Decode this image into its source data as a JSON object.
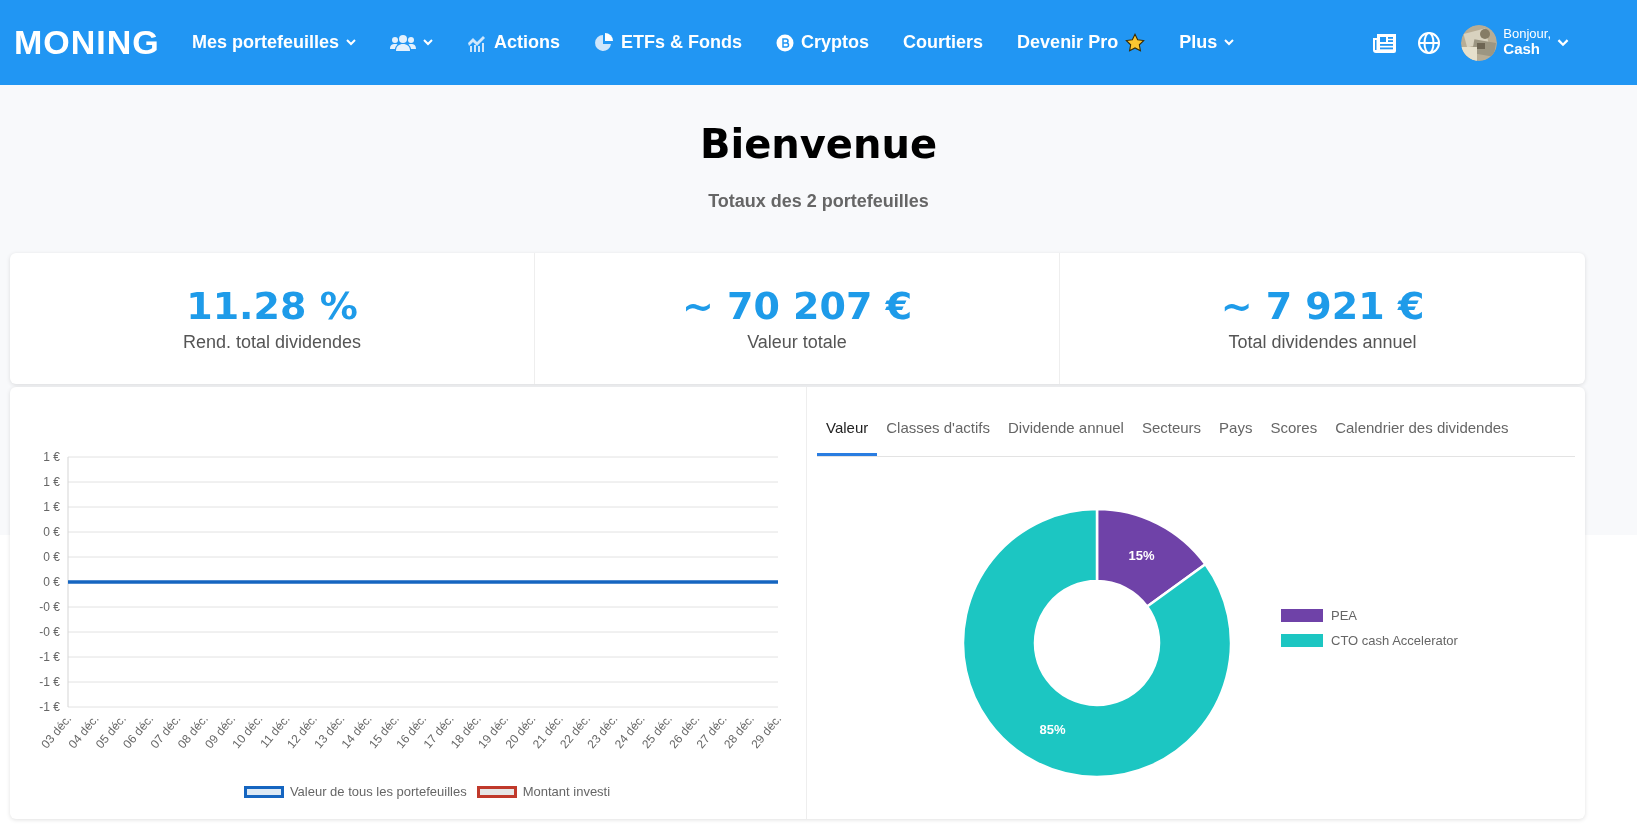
{
  "nav": {
    "brand": "MONING",
    "items": [
      {
        "kind": "menu",
        "label": "Mes portefeuilles",
        "dropdown": true
      },
      {
        "kind": "people",
        "dropdown": true
      },
      {
        "kind": "stocks",
        "label": "Actions",
        "dropdown": false
      },
      {
        "kind": "funds",
        "label": "ETFs & Fonds",
        "dropdown": false
      },
      {
        "kind": "crypto",
        "label": "Cryptos",
        "dropdown": false
      },
      {
        "kind": "menu",
        "label": "Courtiers",
        "dropdown": false
      },
      {
        "kind": "pro",
        "label": "Devenir Pro",
        "dropdown": false
      },
      {
        "kind": "menu",
        "label": "Plus",
        "dropdown": true
      }
    ],
    "user": {
      "greeting": "Bonjour,",
      "name": "Cash"
    }
  },
  "hero": {
    "title": "Bienvenue",
    "subtitle": "Totaux des 2 portefeuilles"
  },
  "stats": [
    {
      "value": "11.28 %",
      "label": "Rend. total dividendes"
    },
    {
      "value": "~ 70 207 €",
      "label": "Valeur totale"
    },
    {
      "value": "~ 7 921 €",
      "label": "Total dividendes annuel"
    }
  ],
  "history": {
    "chart_data": {
      "type": "line",
      "categories": [
        "03 déc.",
        "04 déc.",
        "05 déc.",
        "06 déc.",
        "07 déc.",
        "08 déc.",
        "09 déc.",
        "10 déc.",
        "11 déc.",
        "12 déc.",
        "13 déc.",
        "14 déc.",
        "15 déc.",
        "16 déc.",
        "17 déc.",
        "18 déc.",
        "19 déc.",
        "20 déc.",
        "21 déc.",
        "22 déc.",
        "23 déc.",
        "24 déc.",
        "25 déc.",
        "26 déc.",
        "27 déc.",
        "28 déc.",
        "29 déc."
      ],
      "series": [
        {
          "name": "Valeur de tous les portefeuilles",
          "color": "#1565c0",
          "values": [
            0,
            0,
            0,
            0,
            0,
            0,
            0,
            0,
            0,
            0,
            0,
            0,
            0,
            0,
            0,
            0,
            0,
            0,
            0,
            0,
            0,
            0,
            0,
            0,
            0,
            0,
            0
          ]
        },
        {
          "name": "Montant investi",
          "color": "#c0392b",
          "values": [
            null,
            null,
            null,
            null,
            null,
            null,
            null,
            null,
            null,
            null,
            null,
            null,
            null,
            null,
            null,
            null,
            null,
            null,
            null,
            null,
            null,
            null,
            null,
            null,
            null,
            null,
            null
          ]
        }
      ],
      "grid": true,
      "legend": true,
      "ylim": [
        -1,
        1
      ],
      "yticks": [
        {
          "value": 1,
          "label": "1 €"
        },
        {
          "value": 0.8,
          "label": "1 €"
        },
        {
          "value": 0.6,
          "label": "1 €"
        },
        {
          "value": 0.4,
          "label": "0 €"
        },
        {
          "value": 0.2,
          "label": "0 €"
        },
        {
          "value": 0,
          "label": "0 €"
        },
        {
          "value": -0.2,
          "label": "-0 €"
        },
        {
          "value": -0.4,
          "label": "-0 €"
        },
        {
          "value": -0.6,
          "label": "-1 €"
        },
        {
          "value": -0.8,
          "label": "-1 €"
        },
        {
          "value": -1,
          "label": "-1 €"
        }
      ]
    }
  },
  "tabs": [
    {
      "label": "Valeur",
      "selected": true
    },
    {
      "label": "Classes d'actifs",
      "selected": false
    },
    {
      "label": "Dividende annuel",
      "selected": false
    },
    {
      "label": "Secteurs",
      "selected": false
    },
    {
      "label": "Pays",
      "selected": false
    },
    {
      "label": "Scores",
      "selected": false
    },
    {
      "label": "Calendrier des dividendes",
      "selected": false
    }
  ],
  "allocation": {
    "chart_data": {
      "type": "donut",
      "categories": [
        "PEA",
        "CTO  cash Accelerator"
      ],
      "values": [
        15,
        85
      ],
      "legend": true,
      "colors": [
        "#6f42a8",
        "#1cc6c2"
      ],
      "value_labels": [
        "15%",
        "85%"
      ]
    }
  }
}
